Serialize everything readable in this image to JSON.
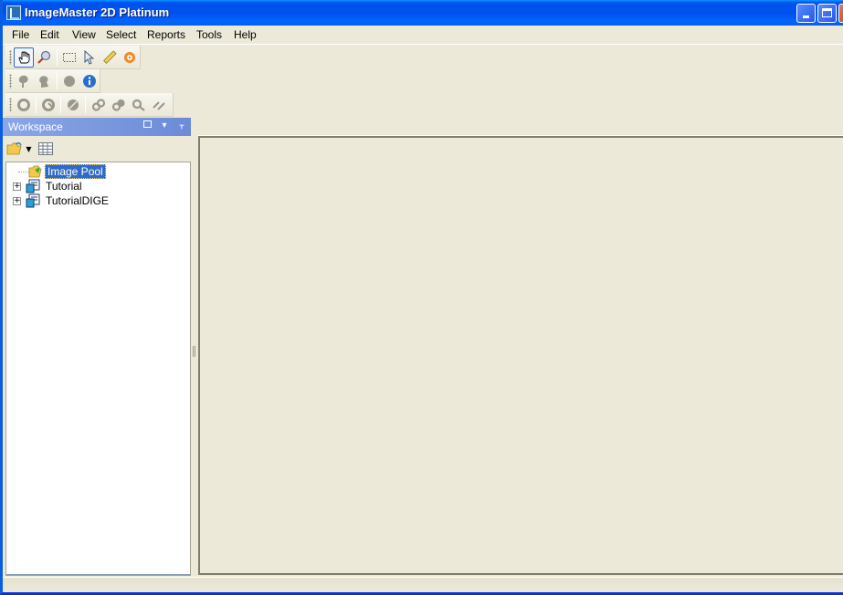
{
  "window": {
    "title": "ImageMaster 2D Platinum",
    "controls": {
      "minimize": "_",
      "maximize": "□",
      "close": "✕"
    }
  },
  "menubar": {
    "items": [
      "File",
      "Edit",
      "View",
      "Select",
      "Reports",
      "Tools",
      "Help"
    ]
  },
  "toolbars": [
    {
      "buttons": [
        "hand-tool",
        "zoom-tool",
        "rectangle-select-tool",
        "pointer-tool",
        "ruler-tool",
        "target-tool"
      ],
      "active": "hand-tool"
    },
    {
      "buttons": [
        "spot-tool",
        "spot-multi-tool",
        "circle-tool",
        "info-tool"
      ]
    },
    {
      "buttons": [
        "ring-tool",
        "refresh-ring-tool",
        "slash-ring-tool",
        "link-tool",
        "link-add-tool",
        "link-search-tool",
        "unlink-tool"
      ]
    }
  ],
  "workspace": {
    "title": "Workspace",
    "header_buttons": [
      "restore",
      "dropdown",
      "pin"
    ],
    "tree": [
      {
        "label": "Image Pool",
        "selected": true,
        "expandable": false
      },
      {
        "label": "Tutorial",
        "selected": false,
        "expandable": true
      },
      {
        "label": "TutorialDIGE",
        "selected": false,
        "expandable": true
      }
    ]
  },
  "colors": {
    "titlebar": "#0053ee",
    "selection": "#316ac5",
    "panel_header": "#7a96df",
    "background": "#ece9d8"
  }
}
